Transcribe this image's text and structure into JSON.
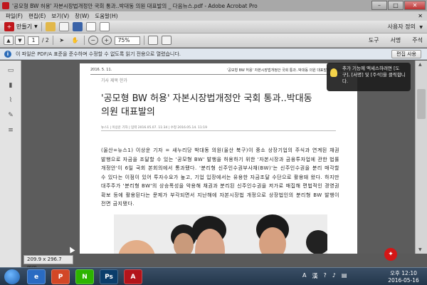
{
  "window": {
    "title": "'공모형 BW 허용' 자본시장법개정안 국회 통과..박대동 의원 대표발의 _ 다음뉴스.pdf - Adobe Acrobat Pro",
    "minimize": "–",
    "maximize": "□",
    "close": "✕"
  },
  "menu": {
    "items": [
      "파일(F)",
      "편집(E)",
      "보기(V)",
      "창(W)",
      "도움말(H)"
    ],
    "close_doc": "✕"
  },
  "toolbar": {
    "make_label": "만들기",
    "customize_label": "사용자 정의"
  },
  "nav": {
    "page_current": "1",
    "page_total": "/ 2",
    "zoom": "75%",
    "tabs": [
      "도구",
      "서명",
      "주석"
    ]
  },
  "infobar": {
    "text": "이 파일은 PDF/A 표준을 준수하며 수정할 수 없도록 읽기 전용으로 열렸습니다.",
    "enable_edit": "편집 사용"
  },
  "page": {
    "header_date": "2016. 5. 11.",
    "header_title": "'공모형 BW 허용' 자본시장법개정안 국회 통과..박대동 의원 대표발의 | 다음뉴스",
    "breadcrumb": "기사 제목 한가",
    "headline": "'공모형 BW 허용' 자본시장법개정안 국회 통과..박대동 의원 대표발의",
    "byline": "뉴스1 | 이상운 기자 | 입력 2016.05.07. 11:34 | 수정 2016.05.14. 11:19",
    "body": "(울산=뉴스1) 이상운 기자 = 새누리당 박대동 의원(울산 북구)이 중소 상장기업의 주식과 연계된 채권 발행으로 자금을 조달할 수 있는 '공모형 BW' 발행을 허용하기 위한 '자본시장과 금융투자업에 관한 법률 개정안'이 6일 국회 본회의에서 통과됐다. '분리형 신주인수권부사채(BW)'는 신주인수권을 분리 매각할 수 있다는 이점이 있어 투자수요가 높고, 기업 입장에서는 유용한 자금조달 수단으로 활용돼 왔다. 하지만 대주주가 '분리형 BW'의 상승폭성을 악용해 채권과 분리된 신주인수권을 저가로 매집해 편법적인 경영권 확보 등에 활용된다는 문제가 부각되면서 지난해에 자본시장법 개정으로 상장법인의 분리형 BW 발행이 전면 금지됐다."
  },
  "tooltip": {
    "text": "추가 기능에 액세스하려면 [도구], [서명] 및 [주석]을 클릭합니다."
  },
  "status": {
    "dimensions": "209.9 x 296.7 mm"
  },
  "taskbar": {
    "app_labels": [
      "e",
      "P",
      "N",
      "Ps",
      "A"
    ],
    "tray": [
      "A",
      "漢",
      "?"
    ],
    "time": "오후 12:10",
    "date": "2016-05-16"
  },
  "colors": {
    "acrobat_red": "#c0171c",
    "info_blue": "#2b6cb8",
    "taskbar_top": "#3b4f66"
  }
}
